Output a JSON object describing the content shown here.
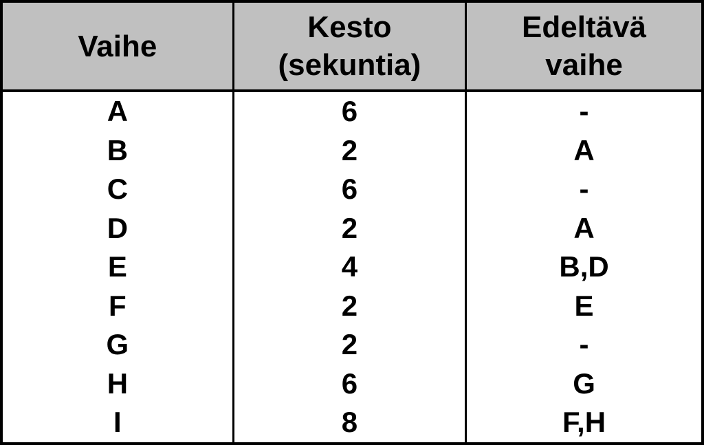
{
  "chart_data": {
    "type": "table",
    "headers": [
      "Vaihe",
      "Kesto (sekuntia)",
      "Edeltävä vaihe"
    ],
    "rows": [
      {
        "vaihe": "A",
        "kesto": 6,
        "edeltava": "-"
      },
      {
        "vaihe": "B",
        "kesto": 2,
        "edeltava": "A"
      },
      {
        "vaihe": "C",
        "kesto": 6,
        "edeltava": "-"
      },
      {
        "vaihe": "D",
        "kesto": 2,
        "edeltava": "A"
      },
      {
        "vaihe": "E",
        "kesto": 4,
        "edeltava": "B,D"
      },
      {
        "vaihe": "F",
        "kesto": 2,
        "edeltava": "E"
      },
      {
        "vaihe": "G",
        "kesto": 2,
        "edeltava": "-"
      },
      {
        "vaihe": "H",
        "kesto": 6,
        "edeltava": "G"
      },
      {
        "vaihe": "I",
        "kesto": 8,
        "edeltava": "F,H"
      }
    ]
  },
  "headers": {
    "col1_line1": "Vaihe",
    "col2_line1": "Kesto",
    "col2_line2": "(sekuntia)",
    "col3_line1": "Edeltävä",
    "col3_line2": "vaihe"
  },
  "rows": {
    "r0": {
      "c0": "A",
      "c1": "6",
      "c2": "-"
    },
    "r1": {
      "c0": "B",
      "c1": "2",
      "c2": "A"
    },
    "r2": {
      "c0": "C",
      "c1": "6",
      "c2": "-"
    },
    "r3": {
      "c0": "D",
      "c1": "2",
      "c2": "A"
    },
    "r4": {
      "c0": "E",
      "c1": "4",
      "c2": "B,D"
    },
    "r5": {
      "c0": "F",
      "c1": "2",
      "c2": "E"
    },
    "r6": {
      "c0": "G",
      "c1": "2",
      "c2": "-"
    },
    "r7": {
      "c0": "H",
      "c1": "6",
      "c2": "G"
    },
    "r8": {
      "c0": "I",
      "c1": "8",
      "c2": "F,H"
    }
  }
}
